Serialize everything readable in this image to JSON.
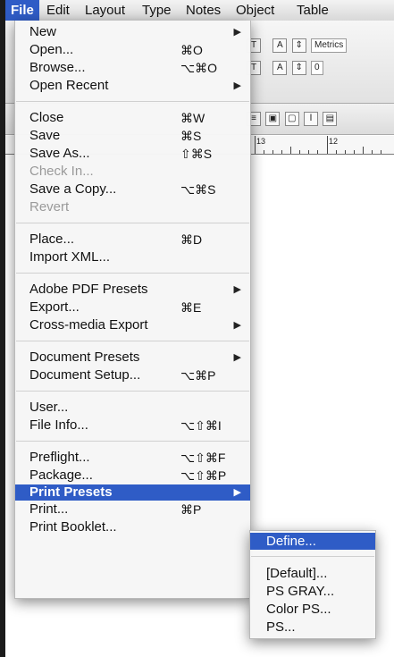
{
  "menubar": {
    "items": [
      "File",
      "Edit",
      "Layout",
      "Type",
      "Notes",
      "Object",
      "Table"
    ]
  },
  "toolbar": {
    "tracking_label": "Metrics",
    "kerning_value": "0",
    "ruler_marks": [
      "13",
      "12"
    ]
  },
  "file_menu": {
    "items": [
      {
        "label": "New",
        "shortcut": "",
        "submenu": true
      },
      {
        "label": "Open...",
        "shortcut": "⌘O"
      },
      {
        "label": "Browse...",
        "shortcut": "⌥⌘O"
      },
      {
        "label": "Open Recent",
        "shortcut": "",
        "submenu": true
      },
      {
        "label": "Close",
        "shortcut": "⌘W"
      },
      {
        "label": "Save",
        "shortcut": "⌘S"
      },
      {
        "label": "Save As...",
        "shortcut": "⇧⌘S"
      },
      {
        "label": "Check In...",
        "shortcut": "",
        "disabled": true
      },
      {
        "label": "Save a Copy...",
        "shortcut": "⌥⌘S"
      },
      {
        "label": "Revert",
        "shortcut": "",
        "disabled": true
      },
      {
        "label": "Place...",
        "shortcut": "⌘D"
      },
      {
        "label": "Import XML...",
        "shortcut": ""
      },
      {
        "label": "Adobe PDF Presets",
        "shortcut": "",
        "submenu": true
      },
      {
        "label": "Export...",
        "shortcut": "⌘E"
      },
      {
        "label": "Cross-media Export",
        "shortcut": "",
        "submenu": true
      },
      {
        "label": "Document Presets",
        "shortcut": "",
        "submenu": true
      },
      {
        "label": "Document Setup...",
        "shortcut": "⌥⌘P"
      },
      {
        "label": "User...",
        "shortcut": ""
      },
      {
        "label": "File Info...",
        "shortcut": "⌥⇧⌘I"
      },
      {
        "label": "Preflight...",
        "shortcut": "⌥⇧⌘F"
      },
      {
        "label": "Package...",
        "shortcut": "⌥⇧⌘P"
      },
      {
        "label": "Print Presets",
        "shortcut": "",
        "submenu": true,
        "highlighted": true
      },
      {
        "label": "Print...",
        "shortcut": "⌘P"
      },
      {
        "label": "Print Booklet...",
        "shortcut": ""
      }
    ]
  },
  "print_presets_submenu": {
    "items": [
      "Define...",
      "[Default]...",
      "PS GRAY...",
      "Color PS...",
      "PS..."
    ]
  },
  "colors": {
    "highlight": "#2f5cc6",
    "disabled_text": "#9a9a9a"
  }
}
